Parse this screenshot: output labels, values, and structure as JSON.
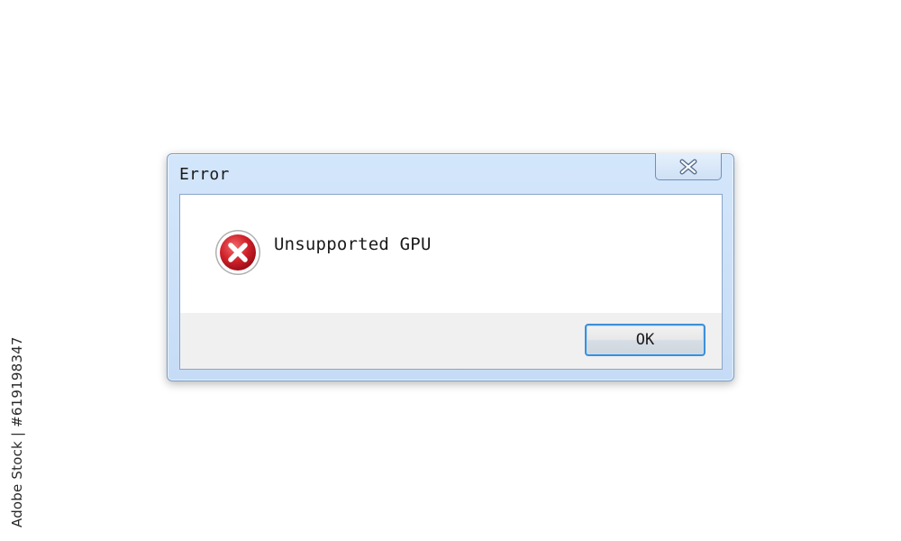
{
  "dialog": {
    "title": "Error",
    "message": "Unsupported GPU",
    "ok_label": "OK",
    "icons": {
      "close": "close-icon",
      "status": "error-icon"
    }
  },
  "watermark": {
    "id_text": "Adobe Stock | #619198347"
  },
  "colors": {
    "frame": "#c6dcf6",
    "button_focus_border": "#3c8fd8",
    "error_red": "#d0202a",
    "button_bar": "#f0f0f0"
  }
}
